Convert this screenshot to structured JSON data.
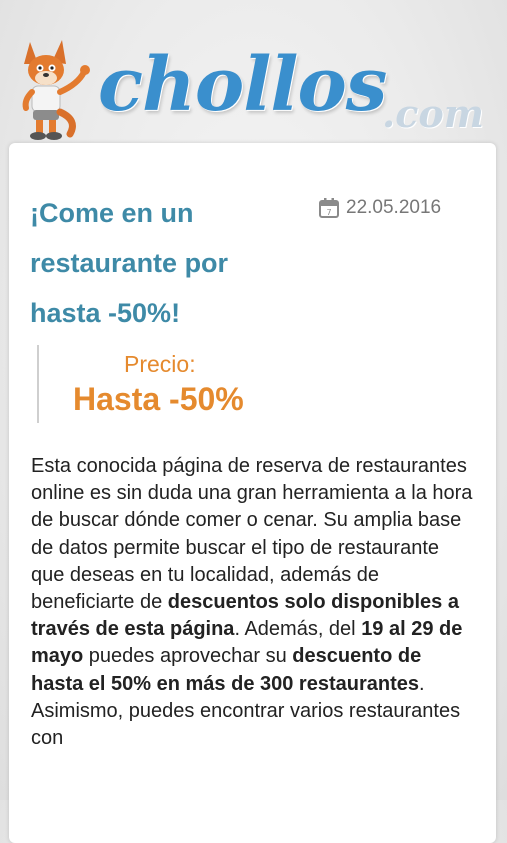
{
  "brand": {
    "logo_main": "chollos",
    "logo_suffix": ".com"
  },
  "article": {
    "title": "¡Come en un restaurante por hasta -50%!",
    "date": "22.05.2016",
    "date_icon": "calendar-icon",
    "price_label": "Precio:",
    "price_value": "Hasta -50%",
    "body": {
      "p1": "Esta conocida página de reserva de restaurantes online es sin duda una gran herramienta a la hora de buscar dónde comer o cenar. Su amplia base de datos permite buscar el tipo de restaurante que deseas en tu localidad, además de beneficiarte de ",
      "b1": "descuentos solo disponibles a través de esta página",
      "p2": ". Además, del ",
      "b2": "19 al 29 de mayo",
      "p3": " puedes aprovechar su ",
      "b3": "descuento de hasta el 50% en más de 300 restaurantes",
      "p4": ". Asimismo, puedes encontrar varios restaurantes con"
    }
  },
  "colors": {
    "title": "#3e8aa7",
    "price": "#e58a2e",
    "logo": "#3a8fcd"
  }
}
